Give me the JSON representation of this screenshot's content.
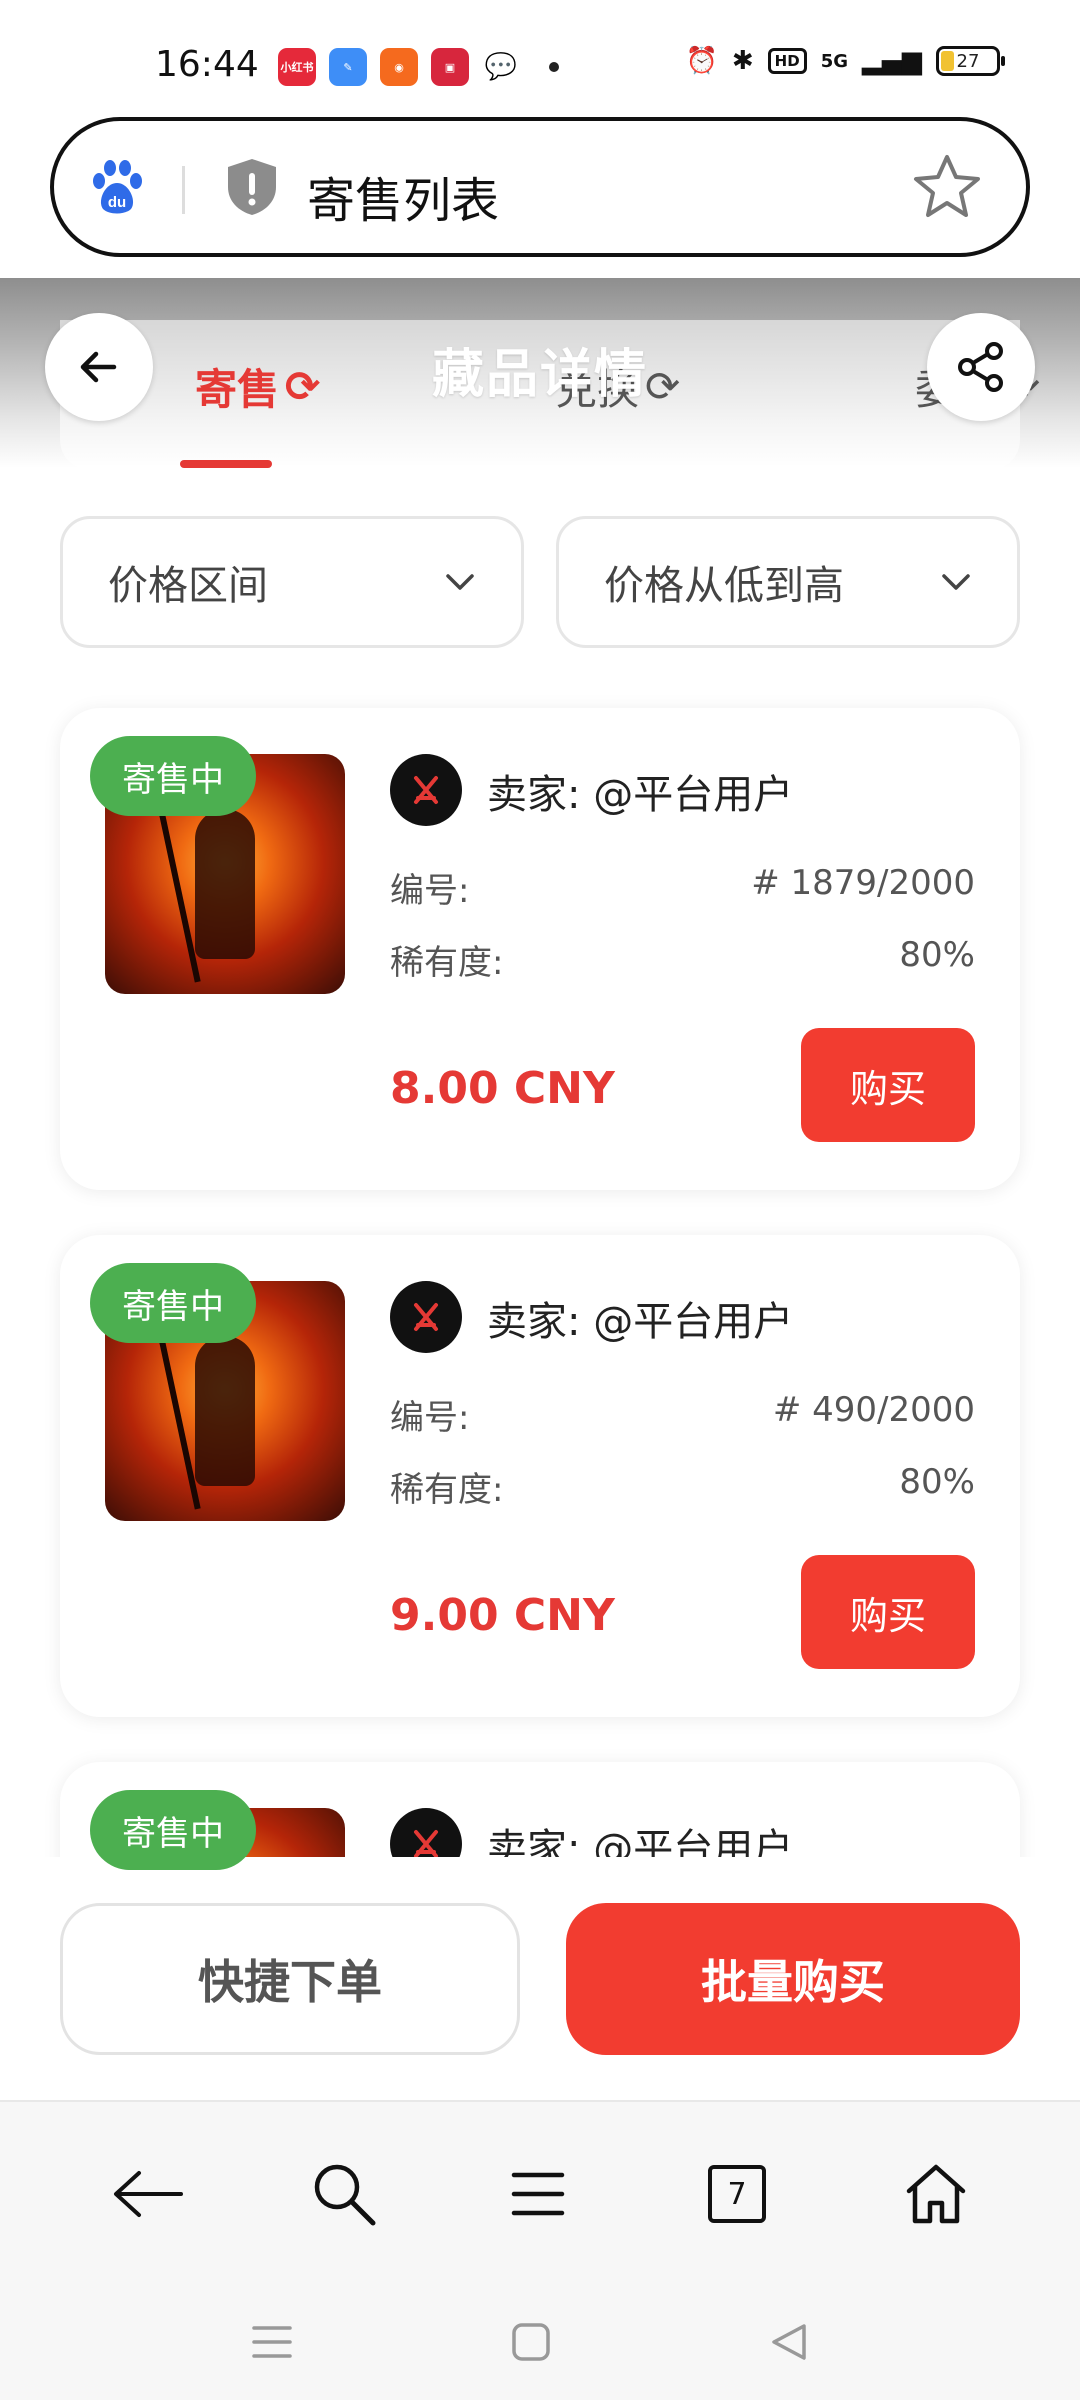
{
  "status_bar": {
    "time": "16:44",
    "app_icons": [
      "xiaohongshu-icon",
      "feather-app-icon",
      "pdd-icon",
      "taobao-icon",
      "wechat-icon"
    ],
    "app_icon_labels": [
      "小红书",
      "",
      "",
      "",
      ""
    ],
    "network": "5G",
    "hd": "HD",
    "battery": "27"
  },
  "address_bar": {
    "title": "寄售列表"
  },
  "header": {
    "title": "藏品详情",
    "tabs": [
      {
        "label": "寄售",
        "active": true
      },
      {
        "label": "兑换",
        "active": false
      },
      {
        "label": "委托",
        "active": false
      }
    ]
  },
  "filters": {
    "price_range": "价格区间",
    "sort": "价格从低到高"
  },
  "listings": [
    {
      "badge": "寄售中",
      "seller": "卖家: @平台用户",
      "number_label": "编号:",
      "number": "# 1879/2000",
      "rarity_label": "稀有度:",
      "rarity": "80%",
      "price": "8.00 CNY",
      "buy_label": "购买"
    },
    {
      "badge": "寄售中",
      "seller": "卖家: @平台用户",
      "number_label": "编号:",
      "number": "# 490/2000",
      "rarity_label": "稀有度:",
      "rarity": "80%",
      "price": "9.00 CNY",
      "buy_label": "购买"
    },
    {
      "badge": "寄售中",
      "seller": "卖家: @平台用户"
    }
  ],
  "actions": {
    "quick_order": "快捷下单",
    "bulk_buy": "批量购买"
  },
  "browser_nav": {
    "tab_count": "7"
  },
  "colors": {
    "accent": "#f23c30",
    "price": "#e53935",
    "badge": "#4caf50"
  }
}
